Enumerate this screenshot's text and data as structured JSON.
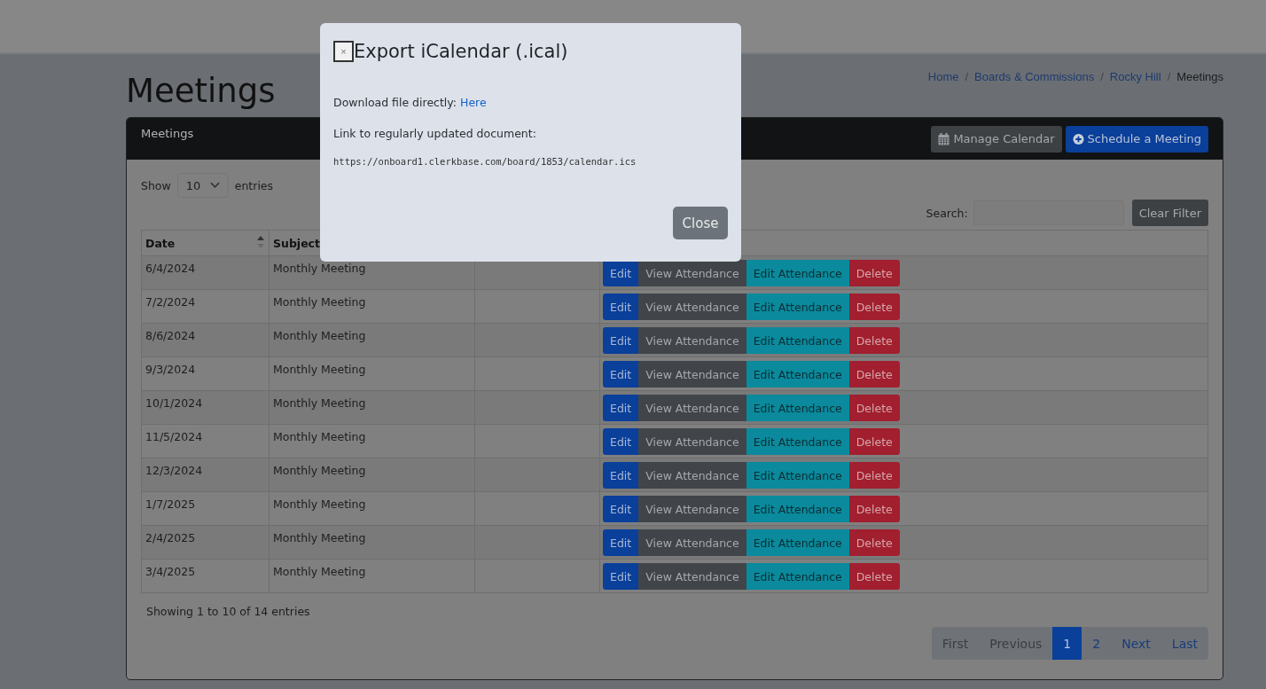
{
  "page_title": "Meetings",
  "breadcrumbs": [
    {
      "label": "Home",
      "kind": "link"
    },
    {
      "separator": "/",
      "label": "Boards & Commissions",
      "kind": "link"
    },
    {
      "separator": "/",
      "label": "Rocky Hill",
      "kind": "link"
    },
    {
      "separator": "/",
      "label": "Meetings",
      "kind": "current"
    }
  ],
  "card": {
    "title": "Meetings",
    "buttons": [
      {
        "label": "Manage Calendar",
        "kind": "secondary"
      },
      {
        "label": "Schedule a Meeting",
        "kind": "primary"
      }
    ]
  },
  "length_control": {
    "before": "Show",
    "value": "10",
    "after": "entries"
  },
  "search": {
    "label": "Search:",
    "clear_button": "Clear Filter"
  },
  "table": {
    "columns": [
      {
        "label": "Date",
        "sorted": true
      },
      {
        "label": "Subject"
      }
    ],
    "rows": [
      {
        "date": "6/4/2024",
        "subject": "Monthly Meeting",
        "actions": [
          {
            "label": "Edit",
            "kind": "edit"
          },
          {
            "label": "View Attendance",
            "kind": "view"
          },
          {
            "label": "Edit Attendance",
            "kind": "attend"
          },
          {
            "label": "Delete",
            "kind": "delete"
          }
        ]
      },
      {
        "date": "7/2/2024",
        "subject": "Monthly Meeting",
        "actions": [
          {
            "label": "Edit",
            "kind": "edit"
          },
          {
            "label": "View Attendance",
            "kind": "view"
          },
          {
            "label": "Edit Attendance",
            "kind": "attend"
          },
          {
            "label": "Delete",
            "kind": "delete"
          }
        ]
      },
      {
        "date": "8/6/2024",
        "subject": "Monthly Meeting",
        "actions": [
          {
            "label": "Edit",
            "kind": "edit"
          },
          {
            "label": "View Attendance",
            "kind": "view"
          },
          {
            "label": "Edit Attendance",
            "kind": "attend"
          },
          {
            "label": "Delete",
            "kind": "delete"
          }
        ]
      },
      {
        "date": "9/3/2024",
        "subject": "Monthly Meeting",
        "actions": [
          {
            "label": "Edit",
            "kind": "edit"
          },
          {
            "label": "View Attendance",
            "kind": "view"
          },
          {
            "label": "Edit Attendance",
            "kind": "attend"
          },
          {
            "label": "Delete",
            "kind": "delete"
          }
        ]
      },
      {
        "date": "10/1/2024",
        "subject": "Monthly Meeting",
        "actions": [
          {
            "label": "Edit",
            "kind": "edit"
          },
          {
            "label": "View Attendance",
            "kind": "view"
          },
          {
            "label": "Edit Attendance",
            "kind": "attend"
          },
          {
            "label": "Delete",
            "kind": "delete"
          }
        ]
      },
      {
        "date": "11/5/2024",
        "subject": "Monthly Meeting",
        "actions": [
          {
            "label": "Edit",
            "kind": "edit"
          },
          {
            "label": "View Attendance",
            "kind": "view"
          },
          {
            "label": "Edit Attendance",
            "kind": "attend"
          },
          {
            "label": "Delete",
            "kind": "delete"
          }
        ]
      },
      {
        "date": "12/3/2024",
        "subject": "Monthly Meeting",
        "actions": [
          {
            "label": "Edit",
            "kind": "edit"
          },
          {
            "label": "View Attendance",
            "kind": "view"
          },
          {
            "label": "Edit Attendance",
            "kind": "attend"
          },
          {
            "label": "Delete",
            "kind": "delete"
          }
        ]
      },
      {
        "date": "1/7/2025",
        "subject": "Monthly Meeting",
        "actions": [
          {
            "label": "Edit",
            "kind": "edit"
          },
          {
            "label": "View Attendance",
            "kind": "view"
          },
          {
            "label": "Edit Attendance",
            "kind": "attend"
          },
          {
            "label": "Delete",
            "kind": "delete"
          }
        ]
      },
      {
        "date": "2/4/2025",
        "subject": "Monthly Meeting",
        "actions": [
          {
            "label": "Edit",
            "kind": "edit"
          },
          {
            "label": "View Attendance",
            "kind": "view"
          },
          {
            "label": "Edit Attendance",
            "kind": "attend"
          },
          {
            "label": "Delete",
            "kind": "delete"
          }
        ]
      },
      {
        "date": "3/4/2025",
        "subject": "Monthly Meeting",
        "actions": [
          {
            "label": "Edit",
            "kind": "edit"
          },
          {
            "label": "View Attendance",
            "kind": "view"
          },
          {
            "label": "Edit Attendance",
            "kind": "attend"
          },
          {
            "label": "Delete",
            "kind": "delete"
          }
        ]
      }
    ]
  },
  "info": "Showing 1 to 10 of 14 entries",
  "pagination": [
    {
      "label": "First",
      "disabled": true,
      "selected": false
    },
    {
      "label": "Previous",
      "disabled": true,
      "selected": false
    },
    {
      "label": "1",
      "disabled": false,
      "selected": true
    },
    {
      "label": "2",
      "disabled": false,
      "selected": false
    },
    {
      "label": "Next",
      "disabled": false,
      "selected": false
    },
    {
      "label": "Last",
      "disabled": false,
      "selected": false
    }
  ],
  "modal": {
    "close_icon": "×",
    "title": "Export iCalendar (.ical)",
    "download_text": "Download file directly: ",
    "download_link": "Here",
    "link_label": "Link to regularly updated document:",
    "url": "https://onboard1.clerkbase.com/board/1853/calendar.ics",
    "close_button": "Close"
  }
}
